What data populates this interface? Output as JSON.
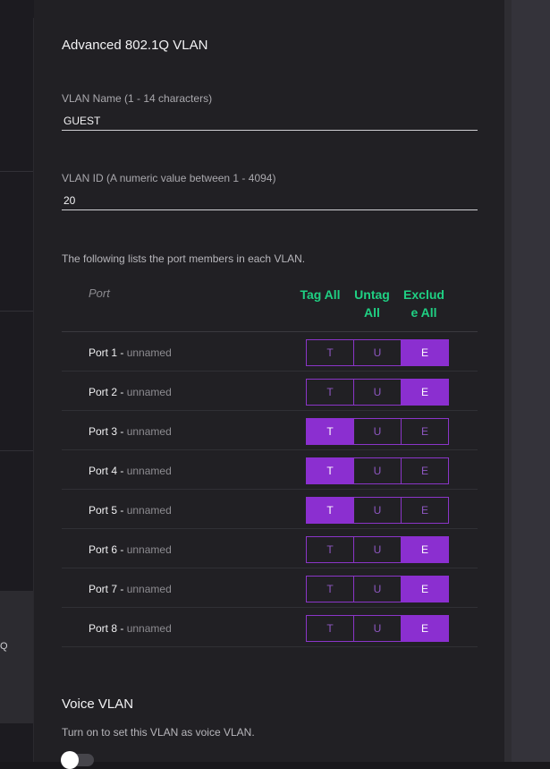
{
  "sidebar": {
    "selected_label": "Q"
  },
  "panel": {
    "title": "Advanced 802.1Q VLAN",
    "vlan_name": {
      "label": "VLAN Name (1 - 14 characters)",
      "value": "GUEST"
    },
    "vlan_id": {
      "label": "VLAN ID (A numeric value between 1 - 4094)",
      "value": "20"
    },
    "members_desc": "The following lists the port members in each VLAN.",
    "table": {
      "header": {
        "port": "Port",
        "tag_all_1": "Tag All",
        "untag_all_1": "Untag",
        "untag_all_2": "All",
        "exclude_all_1": "Exclud",
        "exclude_all_2": "e All"
      },
      "option_labels": {
        "t": "T",
        "u": "U",
        "e": "E"
      },
      "rows": [
        {
          "port": "Port 1 -",
          "name": "unnamed",
          "selected": "E"
        },
        {
          "port": "Port 2 -",
          "name": "unnamed",
          "selected": "E"
        },
        {
          "port": "Port 3 -",
          "name": "unnamed",
          "selected": "T"
        },
        {
          "port": "Port 4 -",
          "name": "unnamed",
          "selected": "T"
        },
        {
          "port": "Port 5 -",
          "name": "unnamed",
          "selected": "T"
        },
        {
          "port": "Port 6 -",
          "name": "unnamed",
          "selected": "E"
        },
        {
          "port": "Port 7 -",
          "name": "unnamed",
          "selected": "E"
        },
        {
          "port": "Port 8 -",
          "name": "unnamed",
          "selected": "E"
        }
      ]
    },
    "voice": {
      "title": "Voice VLAN",
      "desc": "Turn on to set this VLAN as voice VLAN.",
      "enabled": false
    }
  },
  "colors": {
    "accent_purple": "#8b2fd0",
    "header_green": "#1fd083",
    "background": "#212024"
  }
}
